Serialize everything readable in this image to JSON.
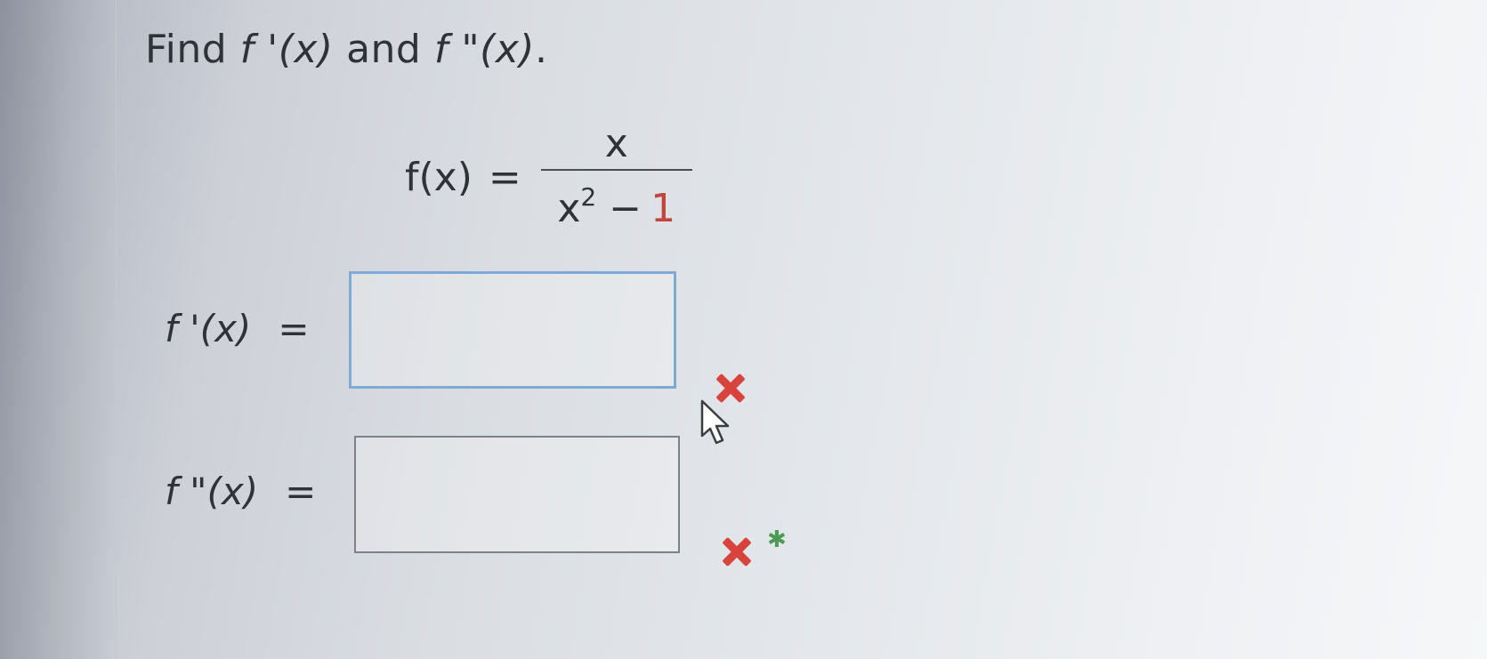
{
  "question": {
    "find": "Find ",
    "f_prime": "f '(x)",
    "and": " and ",
    "f_double_prime": "f \"(x)",
    "period": "."
  },
  "function": {
    "lhs": "f(x)",
    "eq": "=",
    "numerator": "x",
    "den_base": "x",
    "den_exp": "2",
    "den_minus": "−",
    "den_const": "1"
  },
  "answers": {
    "first": {
      "label": "f '(x)",
      "eq": "=",
      "value": ""
    },
    "second": {
      "label": "f \"(x)",
      "eq": "=",
      "value": ""
    }
  },
  "colors": {
    "incorrect_mark": "#d8433d",
    "active_box_border": "#7eaad3",
    "star": "#4d9a55"
  },
  "icons": {
    "incorrect": "x-mark-icon",
    "star": "asterisk-icon",
    "pointer": "mouse-cursor-icon"
  }
}
